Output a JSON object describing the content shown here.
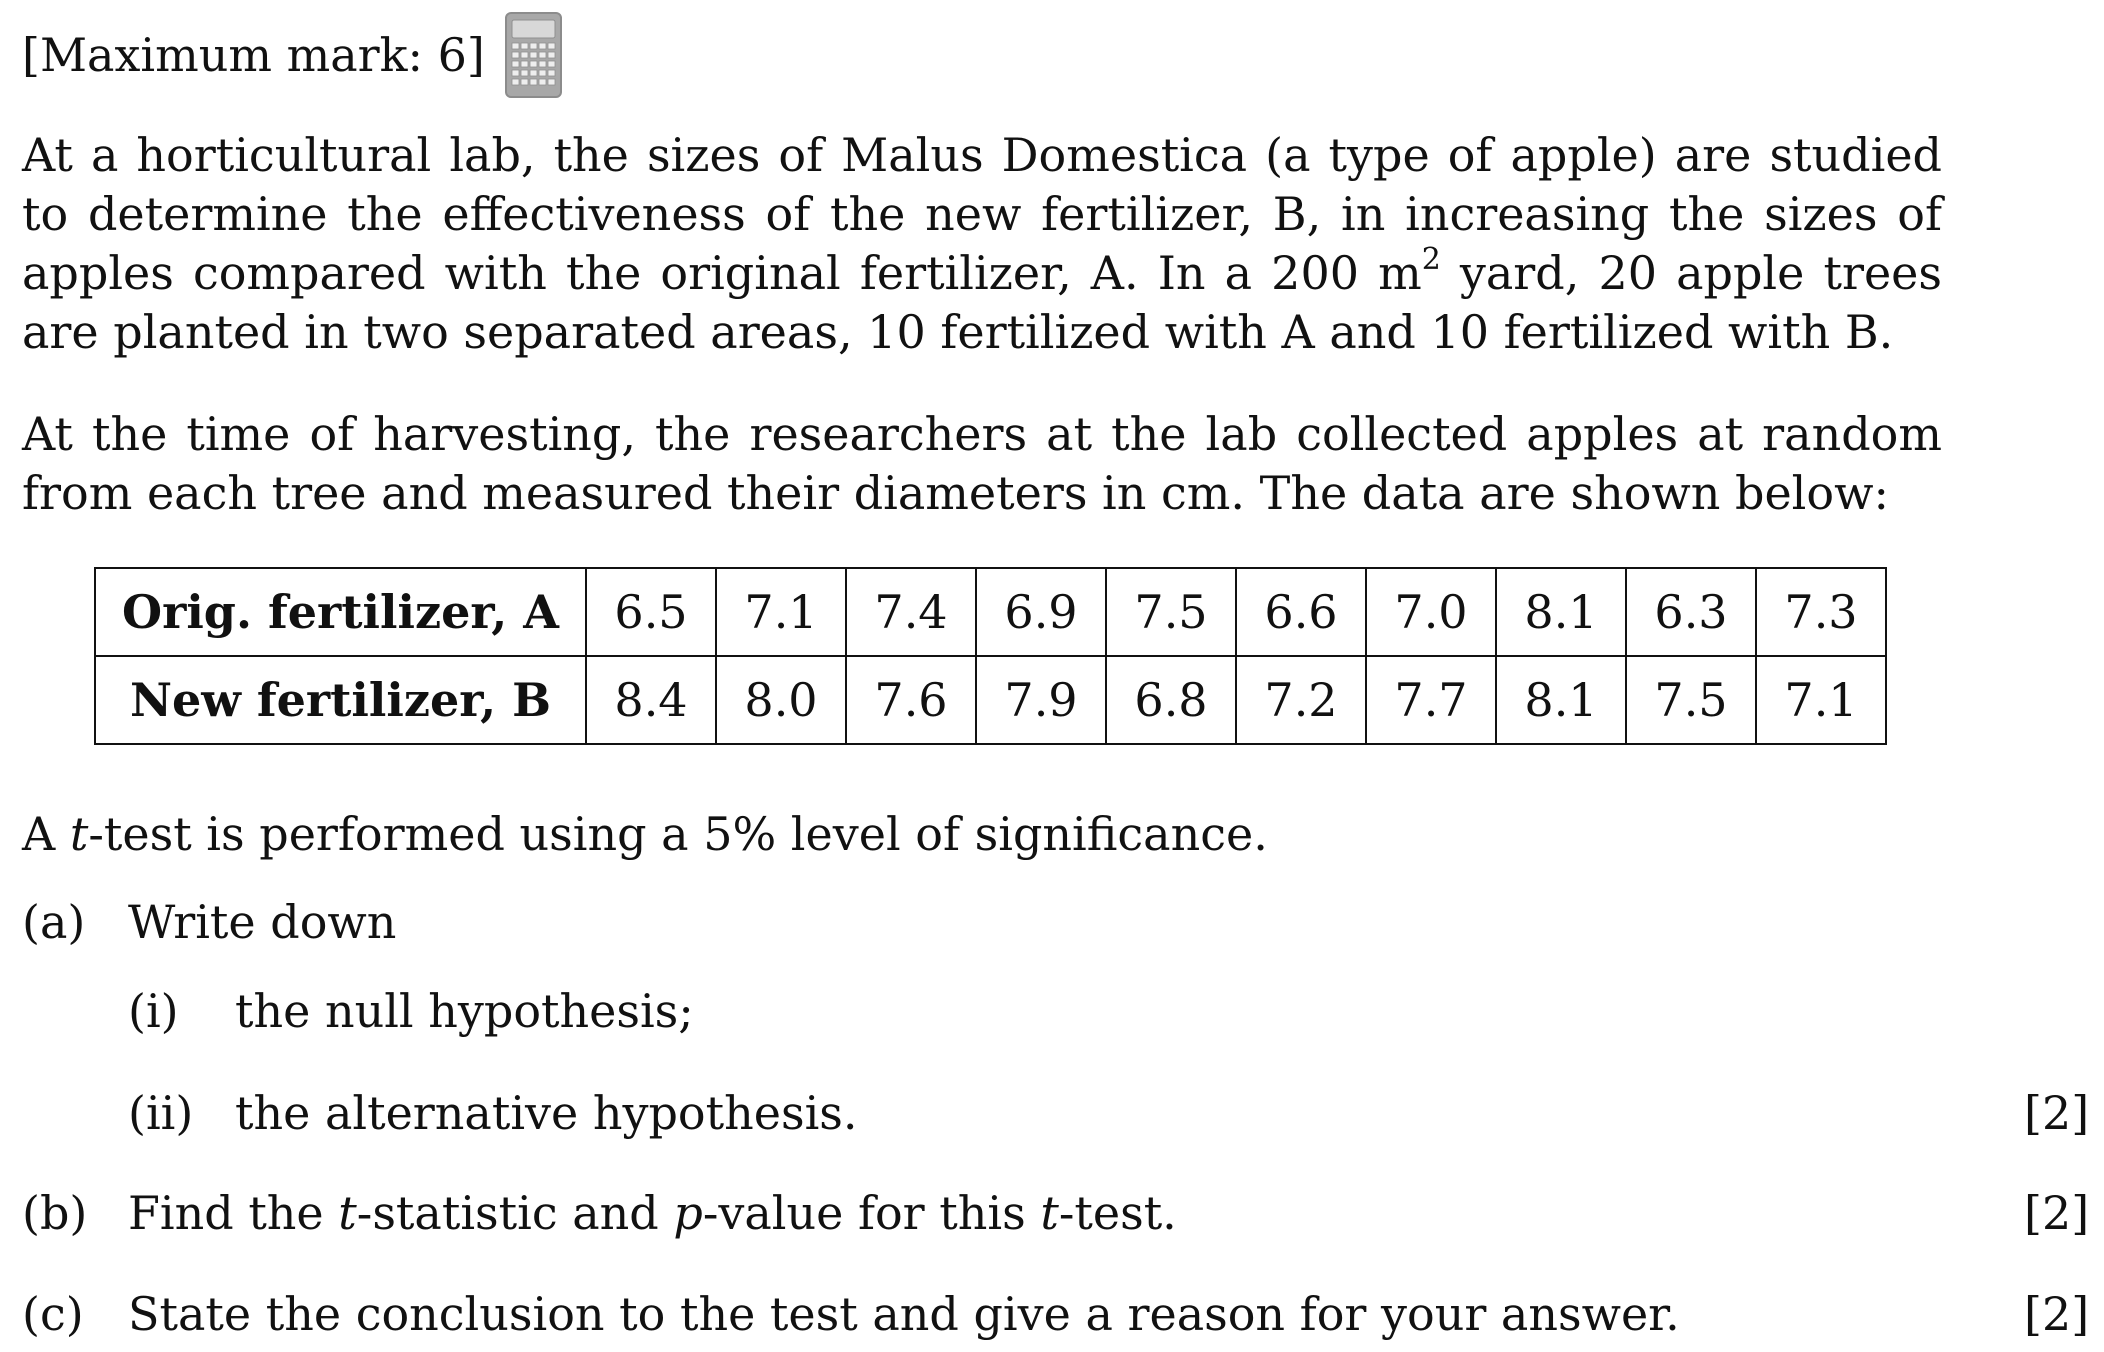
{
  "header": {
    "max_mark": "[Maximum mark: 6]",
    "icon": "calculator-icon"
  },
  "intro": {
    "para1_part1": "At a horticultural lab, the sizes of Malus Domestica (a type of apple) are studied to determine the effectiveness of the new fertilizer, B, in increasing the sizes of apples compared with the original fertilizer, A. In a 200 m",
    "para1_superscript": "2",
    "para1_part2": " yard, 20 apple trees are planted in two separated areas, 10 fertilized with A and 10 fertilized with B.",
    "para2": "At the time of harvesting, the researchers at the lab collected apples at random from each tree and measured their diameters in cm. The data are shown below:"
  },
  "table": {
    "rows": [
      {
        "label": "Orig. fertilizer, A",
        "values": [
          "6.5",
          "7.1",
          "7.4",
          "6.9",
          "7.5",
          "6.6",
          "7.0",
          "8.1",
          "6.3",
          "7.3"
        ]
      },
      {
        "label": "New fertilizer, B",
        "values": [
          "8.4",
          "8.0",
          "7.6",
          "7.9",
          "6.8",
          "7.2",
          "7.7",
          "8.1",
          "7.5",
          "7.1"
        ]
      }
    ]
  },
  "test_statement": {
    "prefix": "A ",
    "italic_t": "t",
    "suffix": "-test is performed using a 5% level of significance."
  },
  "questions": {
    "a": {
      "label": "(a)",
      "text": "Write down",
      "parts": {
        "i": {
          "label": "(i)",
          "text": "the null hypothesis;"
        },
        "ii": {
          "label": "(ii)",
          "text": "the alternative hypothesis.",
          "marks": "[2]"
        }
      }
    },
    "b": {
      "label": "(b)",
      "text_part1": "Find the ",
      "italic1": "t",
      "text_part2": "-statistic and ",
      "italic2": "p",
      "text_part3": "-value for this ",
      "italic3": "t",
      "text_part4": "-test.",
      "marks": "[2]"
    },
    "c": {
      "label": "(c)",
      "text": "State the conclusion to the test and give a reason for your answer.",
      "marks": "[2]"
    }
  }
}
